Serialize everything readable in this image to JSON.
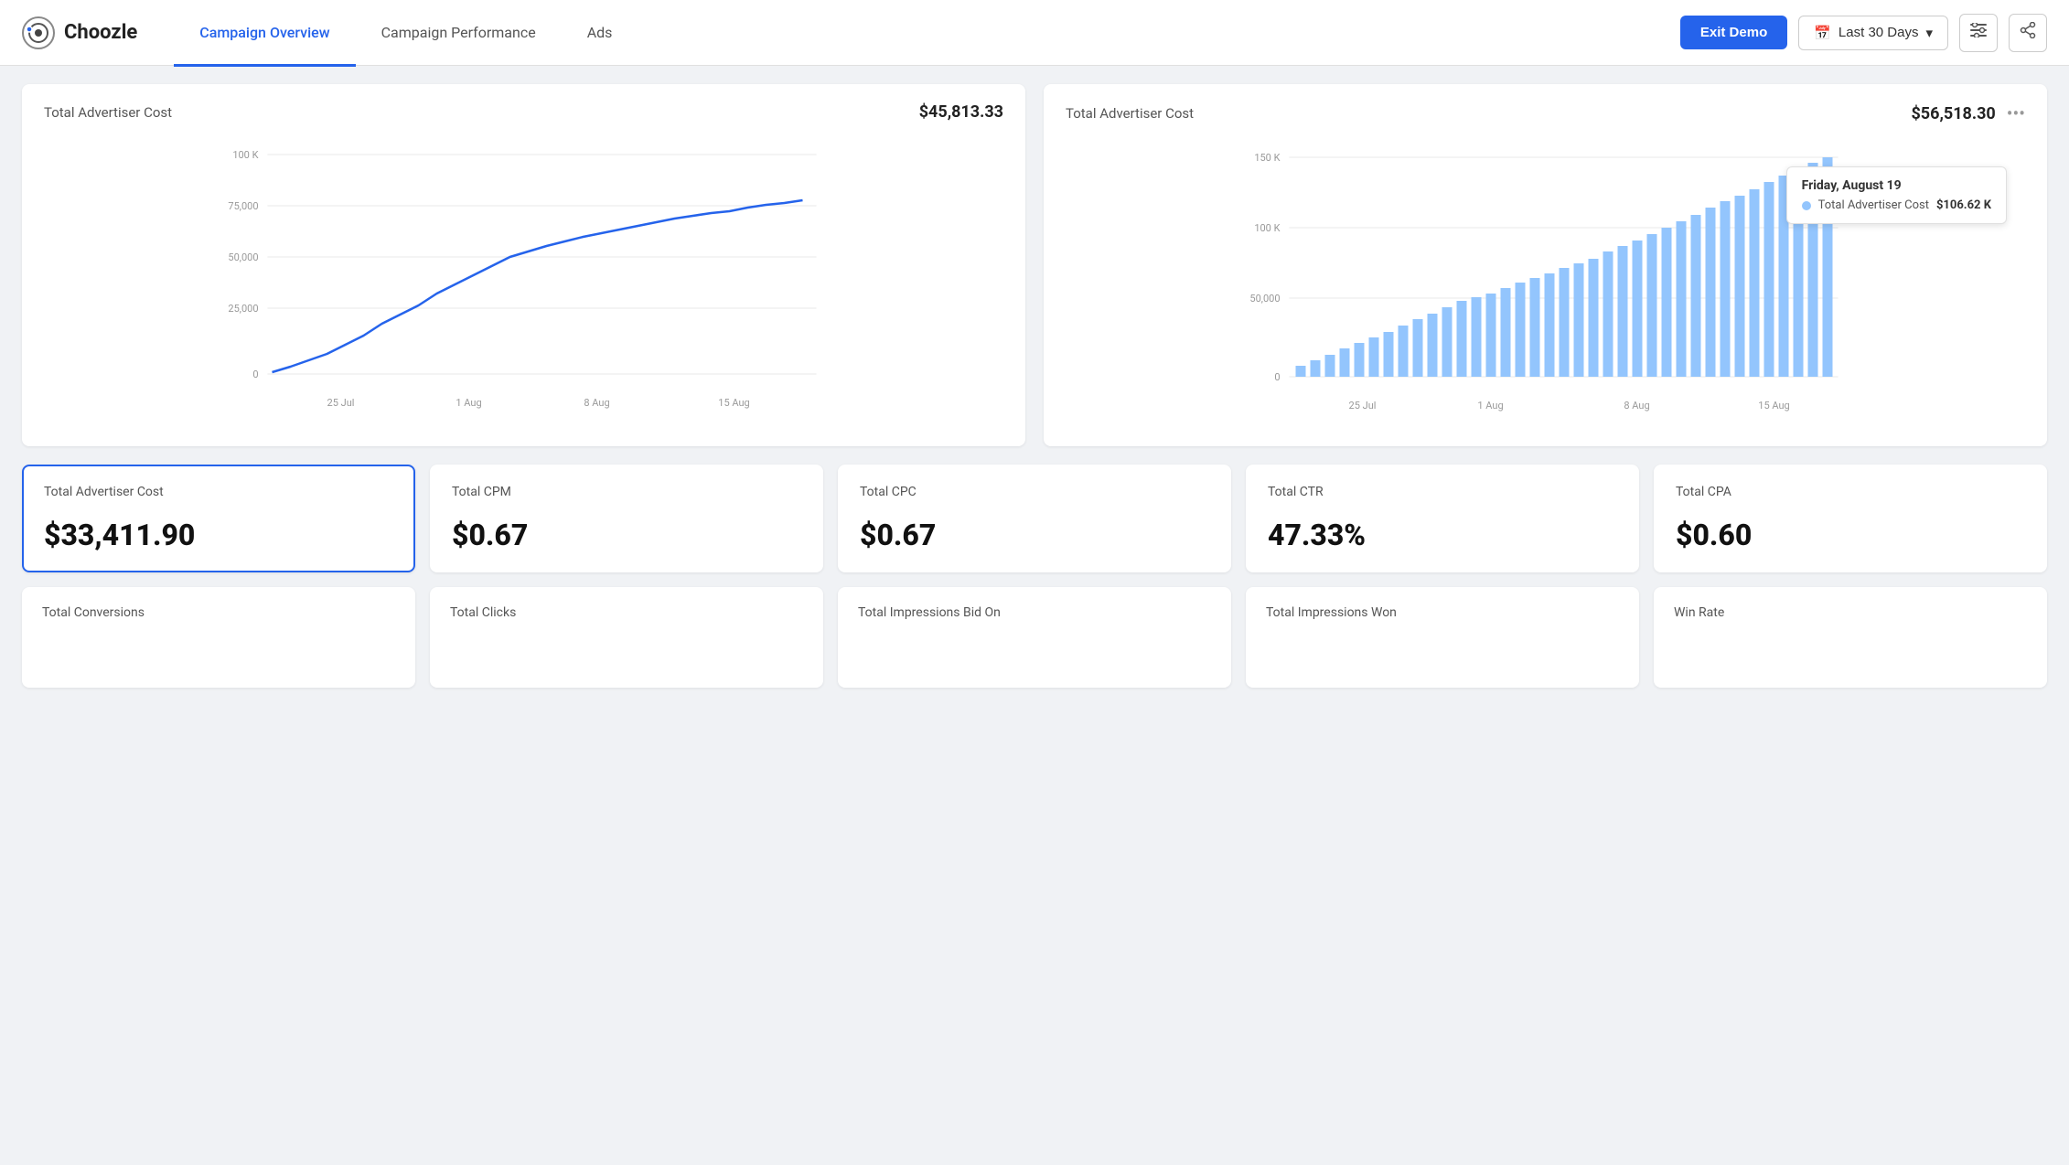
{
  "header": {
    "logo_text": "Choozle",
    "nav": [
      {
        "id": "campaign-overview",
        "label": "Campaign Overview",
        "active": true
      },
      {
        "id": "campaign-performance",
        "label": "Campaign Performance",
        "active": false
      },
      {
        "id": "ads",
        "label": "Ads",
        "active": false
      }
    ],
    "exit_demo_label": "Exit Demo",
    "date_filter_label": "Last 30 Days",
    "filter_icon": "≡",
    "share_icon": "⤢"
  },
  "charts": {
    "left": {
      "title": "Total Advertiser Cost",
      "value": "$45,813.33",
      "y_labels": [
        "100 K",
        "75,000",
        "50,000",
        "25,000",
        "0"
      ],
      "x_labels": [
        "25 Jul",
        "1 Aug",
        "8 Aug",
        "15 Aug"
      ]
    },
    "right": {
      "title": "Total Advertiser Cost",
      "value": "$56,518.30",
      "y_labels": [
        "150 K",
        "100 K",
        "50,000",
        "0"
      ],
      "x_labels": [
        "25 Jul",
        "1 Aug",
        "8 Aug",
        "15 Aug"
      ],
      "tooltip": {
        "date": "Friday, August 19",
        "label": "Total Advertiser Cost",
        "value": "$106.62 K"
      }
    }
  },
  "metrics": [
    {
      "id": "total-advertiser-cost",
      "label": "Total Advertiser Cost",
      "value": "$33,411.90",
      "selected": true
    },
    {
      "id": "total-cpm",
      "label": "Total CPM",
      "value": "$0.67",
      "selected": false
    },
    {
      "id": "total-cpc",
      "label": "Total CPC",
      "value": "$0.67",
      "selected": false
    },
    {
      "id": "total-ctr",
      "label": "Total CTR",
      "value": "47.33%",
      "selected": false
    },
    {
      "id": "total-cpa",
      "label": "Total CPA",
      "value": "$0.60",
      "selected": false
    }
  ],
  "bottom_metrics": [
    {
      "id": "total-conversions",
      "label": "Total Conversions"
    },
    {
      "id": "total-clicks",
      "label": "Total Clicks"
    },
    {
      "id": "total-impressions-bid-on",
      "label": "Total Impressions Bid On"
    },
    {
      "id": "total-impressions-won",
      "label": "Total Impressions Won"
    },
    {
      "id": "win-rate",
      "label": "Win Rate"
    }
  ]
}
